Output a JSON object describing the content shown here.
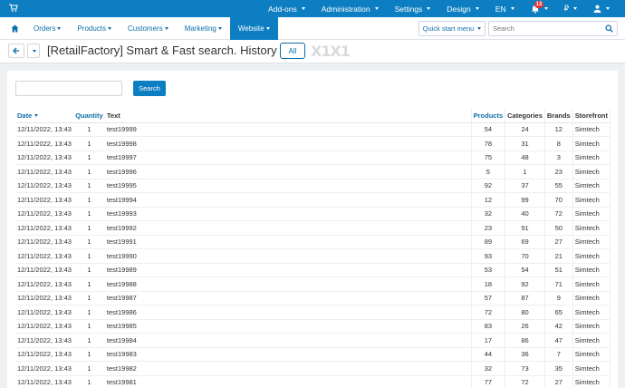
{
  "topbar": {
    "items": [
      {
        "label": "Add-ons"
      },
      {
        "label": "Administration"
      },
      {
        "label": "Settings"
      },
      {
        "label": "Design"
      },
      {
        "label": "EN"
      },
      {
        "label": "₽"
      }
    ],
    "notification_count": "13"
  },
  "nav": {
    "items": [
      {
        "label": "Orders"
      },
      {
        "label": "Products"
      },
      {
        "label": "Customers"
      },
      {
        "label": "Marketing"
      },
      {
        "label": "Website"
      }
    ],
    "active": "Website",
    "quick_start_label": "Quick start menu",
    "search_placeholder": "Search"
  },
  "titlebar": {
    "title": "[RetailFactory] Smart & Fast search. History",
    "all_label": "All",
    "logo_text": "X1X1"
  },
  "filter": {
    "search_value": "",
    "search_button": "Search"
  },
  "table": {
    "headers": {
      "date": "Date",
      "quantity": "Quantity",
      "text": "Text",
      "products": "Products",
      "categories": "Categories",
      "brands": "Brands",
      "storefront": "Storefront"
    },
    "rows": [
      {
        "date": "12/11/2022, 13:43",
        "quantity": "1",
        "text": "test19999",
        "products": "54",
        "categories": "24",
        "brands": "12",
        "storefront": "Simtech"
      },
      {
        "date": "12/11/2022, 13:43",
        "quantity": "1",
        "text": "test19998",
        "products": "78",
        "categories": "31",
        "brands": "8",
        "storefront": "Simtech"
      },
      {
        "date": "12/11/2022, 13:43",
        "quantity": "1",
        "text": "test19997",
        "products": "75",
        "categories": "48",
        "brands": "3",
        "storefront": "Simtech"
      },
      {
        "date": "12/11/2022, 13:43",
        "quantity": "1",
        "text": "test19996",
        "products": "5",
        "categories": "1",
        "brands": "23",
        "storefront": "Simtech"
      },
      {
        "date": "12/11/2022, 13:43",
        "quantity": "1",
        "text": "test19995",
        "products": "92",
        "categories": "37",
        "brands": "55",
        "storefront": "Simtech"
      },
      {
        "date": "12/11/2022, 13:43",
        "quantity": "1",
        "text": "test19994",
        "products": "12",
        "categories": "99",
        "brands": "70",
        "storefront": "Simtech"
      },
      {
        "date": "12/11/2022, 13:43",
        "quantity": "1",
        "text": "test19993",
        "products": "32",
        "categories": "40",
        "brands": "72",
        "storefront": "Simtech"
      },
      {
        "date": "12/11/2022, 13:43",
        "quantity": "1",
        "text": "test19992",
        "products": "23",
        "categories": "91",
        "brands": "50",
        "storefront": "Simtech"
      },
      {
        "date": "12/11/2022, 13:43",
        "quantity": "1",
        "text": "test19991",
        "products": "89",
        "categories": "69",
        "brands": "27",
        "storefront": "Simtech"
      },
      {
        "date": "12/11/2022, 13:43",
        "quantity": "1",
        "text": "test19990",
        "products": "93",
        "categories": "70",
        "brands": "21",
        "storefront": "Simtech"
      },
      {
        "date": "12/11/2022, 13:43",
        "quantity": "1",
        "text": "test19989",
        "products": "53",
        "categories": "54",
        "brands": "51",
        "storefront": "Simtech"
      },
      {
        "date": "12/11/2022, 13:43",
        "quantity": "1",
        "text": "test19988",
        "products": "18",
        "categories": "92",
        "brands": "71",
        "storefront": "Simtech"
      },
      {
        "date": "12/11/2022, 13:43",
        "quantity": "1",
        "text": "test19987",
        "products": "57",
        "categories": "87",
        "brands": "9",
        "storefront": "Simtech"
      },
      {
        "date": "12/11/2022, 13:43",
        "quantity": "1",
        "text": "test19986",
        "products": "72",
        "categories": "80",
        "brands": "65",
        "storefront": "Simtech"
      },
      {
        "date": "12/11/2022, 13:43",
        "quantity": "1",
        "text": "test19985",
        "products": "83",
        "categories": "26",
        "brands": "42",
        "storefront": "Simtech"
      },
      {
        "date": "12/11/2022, 13:43",
        "quantity": "1",
        "text": "test19984",
        "products": "17",
        "categories": "86",
        "brands": "47",
        "storefront": "Simtech"
      },
      {
        "date": "12/11/2022, 13:43",
        "quantity": "1",
        "text": "test19983",
        "products": "44",
        "categories": "36",
        "brands": "7",
        "storefront": "Simtech"
      },
      {
        "date": "12/11/2022, 13:43",
        "quantity": "1",
        "text": "test19982",
        "products": "32",
        "categories": "73",
        "brands": "35",
        "storefront": "Simtech"
      },
      {
        "date": "12/11/2022, 13:43",
        "quantity": "1",
        "text": "test19981",
        "products": "77",
        "categories": "72",
        "brands": "27",
        "storefront": "Simtech"
      }
    ]
  },
  "colors": {
    "accent": "#0d7ec1",
    "link": "#0d6ea8",
    "badge": "#e2343b"
  },
  "icons": {
    "cart": "cart-icon",
    "home": "home-icon",
    "bell": "bell-icon",
    "user": "user-icon",
    "search": "search-icon",
    "back": "arrow-left-icon"
  }
}
